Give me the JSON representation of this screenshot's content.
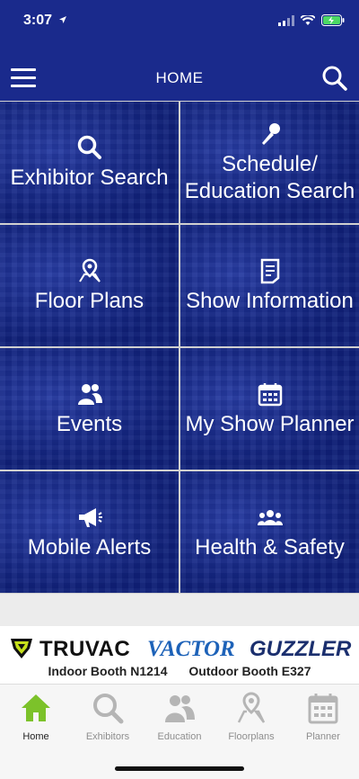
{
  "status_bar": {
    "time": "3:07",
    "icons": [
      "location-arrow-icon",
      "cellular-signal-icon",
      "wifi-icon",
      "battery-charging-icon"
    ]
  },
  "header": {
    "title": "HOME",
    "icons": [
      "hamburger-menu-icon",
      "search-icon"
    ]
  },
  "tiles": [
    {
      "label": "Exhibitor Search",
      "icon": "search-icon"
    },
    {
      "label": "Schedule/\nEducation Search",
      "icon": "microphone-icon"
    },
    {
      "label": "Floor Plans",
      "icon": "map-pin-icon"
    },
    {
      "label": "Show Information",
      "icon": "document-icon"
    },
    {
      "label": "Events",
      "icon": "users-icon"
    },
    {
      "label": "My Show Planner",
      "icon": "calendar-icon"
    },
    {
      "label": "Mobile Alerts",
      "icon": "megaphone-icon"
    },
    {
      "label": "Health & Safety",
      "icon": "group-icon"
    }
  ],
  "banner": {
    "brands": [
      "TRUVAC",
      "VACTOR",
      "GUZZLER"
    ],
    "indoor_booth": "Indoor Booth N1214",
    "outdoor_booth": "Outdoor Booth E327"
  },
  "tabs": [
    {
      "label": "Home",
      "icon": "home-icon",
      "active": true
    },
    {
      "label": "Exhibitors",
      "icon": "search-icon",
      "active": false
    },
    {
      "label": "Education",
      "icon": "users-icon",
      "active": false
    },
    {
      "label": "Floorplans",
      "icon": "map-pin-icon",
      "active": false
    },
    {
      "label": "Planner",
      "icon": "calendar-icon",
      "active": false
    }
  ],
  "colors": {
    "header_bg": "#1a2a8c",
    "active_tab": "#7cc22a",
    "inactive_tab": "#b5b5b5",
    "vactor_blue": "#1d62b8"
  }
}
